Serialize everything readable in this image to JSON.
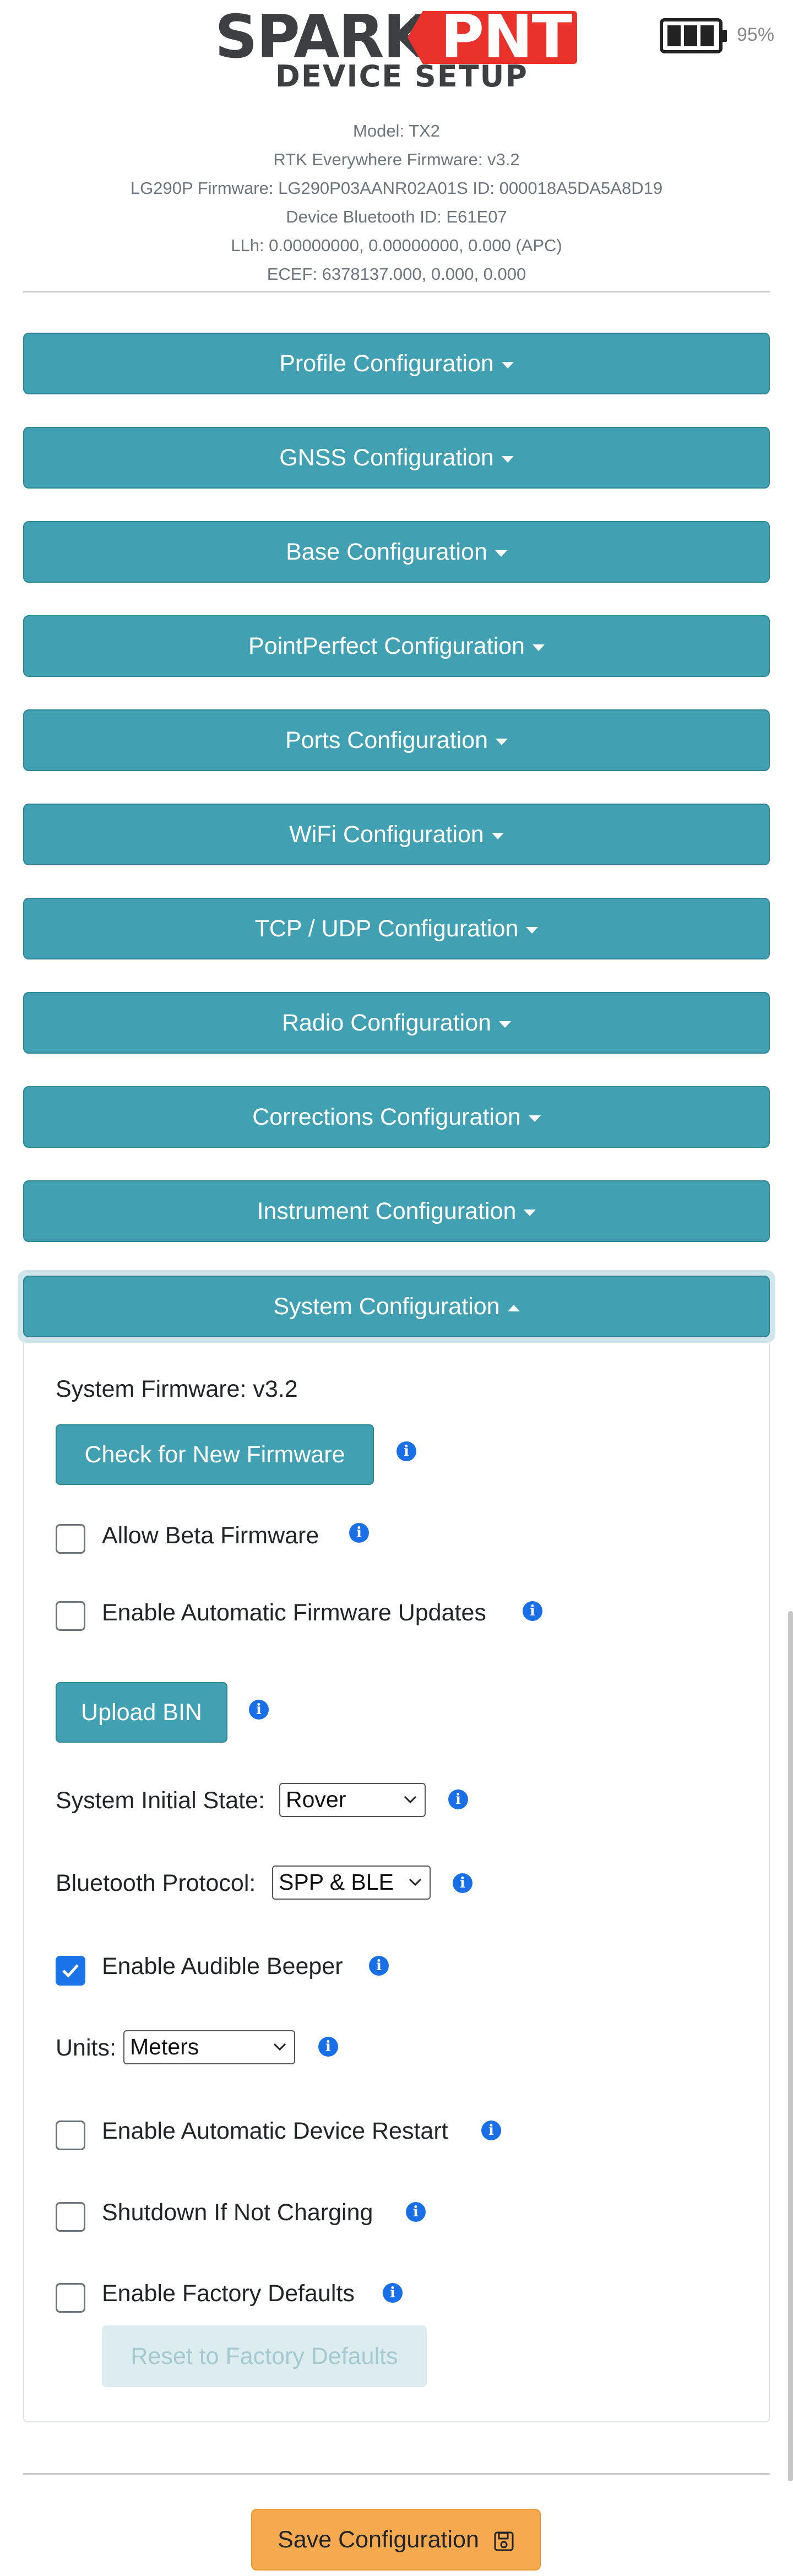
{
  "header": {
    "logo_spark": "SPARK",
    "logo_pnt": "PNT",
    "logo_subtitle": "DEVICE SETUP",
    "battery_percent": "95%",
    "battery_icon": "battery-icon"
  },
  "device_info": {
    "model": "Model: TX2",
    "firmware": "RTK Everywhere Firmware: v3.2",
    "gnss_firmware": "LG290P Firmware: LG290P03AANR02A01S ID: 000018A5DA5A8D19",
    "bluetooth_id": "Device Bluetooth ID: E61E07",
    "llh": "LLh: 0.00000000, 0.00000000, 0.000 (APC)",
    "ecef": "ECEF: 6378137.000, 0.000, 0.000"
  },
  "sections": [
    {
      "label": "Profile Configuration"
    },
    {
      "label": "GNSS Configuration"
    },
    {
      "label": "Base Configuration"
    },
    {
      "label": "PointPerfect Configuration"
    },
    {
      "label": "Ports Configuration"
    },
    {
      "label": "WiFi Configuration"
    },
    {
      "label": "TCP / UDP Configuration"
    },
    {
      "label": "Radio Configuration"
    },
    {
      "label": "Corrections Configuration"
    },
    {
      "label": "Instrument Configuration"
    },
    {
      "label": "System Configuration"
    }
  ],
  "system": {
    "firmware_label": "System Firmware: v3.2",
    "check_firmware_button": "Check for New Firmware",
    "allow_beta_label": "Allow Beta Firmware",
    "allow_beta_checked": false,
    "auto_updates_label": "Enable Automatic Firmware Updates",
    "auto_updates_checked": false,
    "upload_bin_button": "Upload BIN",
    "initial_state_label": "System Initial State:",
    "initial_state_value": "Rover",
    "bt_protocol_label": "Bluetooth Protocol:",
    "bt_protocol_value": "SPP & BLE",
    "beeper_label": "Enable Audible Beeper",
    "beeper_checked": true,
    "units_label": "Units:",
    "units_value": "Meters",
    "auto_restart_label": "Enable Automatic Device Restart",
    "auto_restart_checked": false,
    "shutdown_label": "Shutdown If Not Charging",
    "shutdown_checked": false,
    "factory_defaults_label": "Enable Factory Defaults",
    "factory_defaults_checked": false,
    "reset_button": "Reset to Factory Defaults"
  },
  "footer": {
    "save_button": "Save Configuration"
  },
  "colors": {
    "accent": "#41a1b2",
    "checkbox_blue": "#1a73e8",
    "info_icon_blue": "#1a6ee6",
    "save_orange": "#f6a94f",
    "logo_red": "#e8322b"
  }
}
